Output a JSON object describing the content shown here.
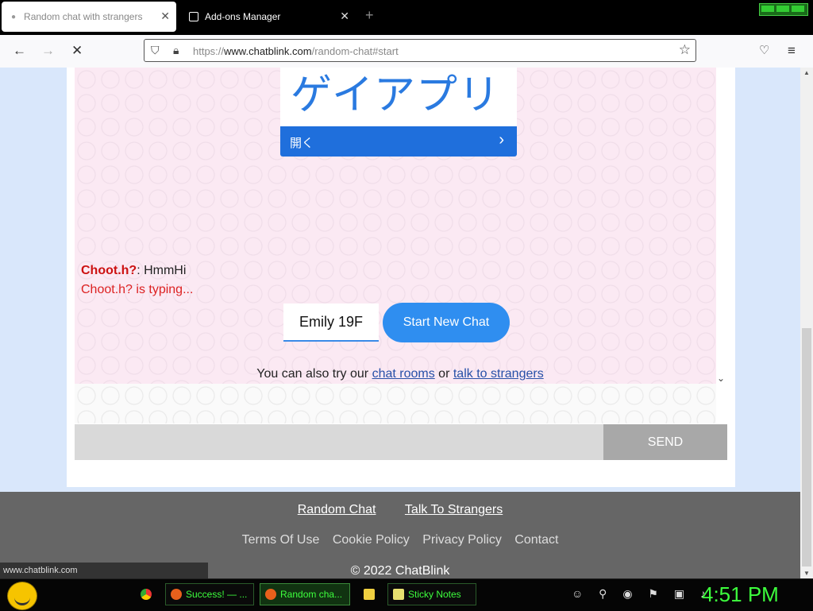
{
  "browser": {
    "tabs": [
      {
        "title": "Random chat with strangers",
        "active": true
      },
      {
        "title": "Add-ons Manager",
        "active": false
      }
    ],
    "new_tab_icon": "+",
    "url_domain": "www.chatblink.com",
    "url_prefix": "https://",
    "url_path": "/random-chat#start"
  },
  "ad": {
    "headline": "ゲイアプリ",
    "cta": "開く"
  },
  "chat": {
    "sender": "Choot.h?",
    "separator": ": ",
    "message": "HmmHi",
    "typing_status": "Choot.h? is typing..."
  },
  "controls": {
    "name_value": "Emily 19F",
    "start_label": "Start New Chat",
    "also_try_prefix": "You can also try our",
    "chat_rooms_link": "chat rooms",
    "or_text": "or",
    "strangers_link": "talk to strangers",
    "send_label": "SEND"
  },
  "footer": {
    "links_primary": [
      "Random Chat",
      "Talk To Strangers"
    ],
    "links_secondary": [
      "Terms Of Use",
      "Cookie Policy",
      "Privacy Policy",
      "Contact"
    ],
    "copyright": "© 2022 ChatBlink"
  },
  "status_url": "www.chatblink.com",
  "taskbar": {
    "items": [
      {
        "label": "Success! — ..."
      },
      {
        "label": "Random cha..."
      },
      {
        "label": "Sticky Notes"
      }
    ],
    "clock": "4:51 PM"
  },
  "colors": {
    "accent_blue": "#2f8ef0",
    "nick_red": "#cc1111",
    "taskbar_green": "#3dff3d"
  }
}
